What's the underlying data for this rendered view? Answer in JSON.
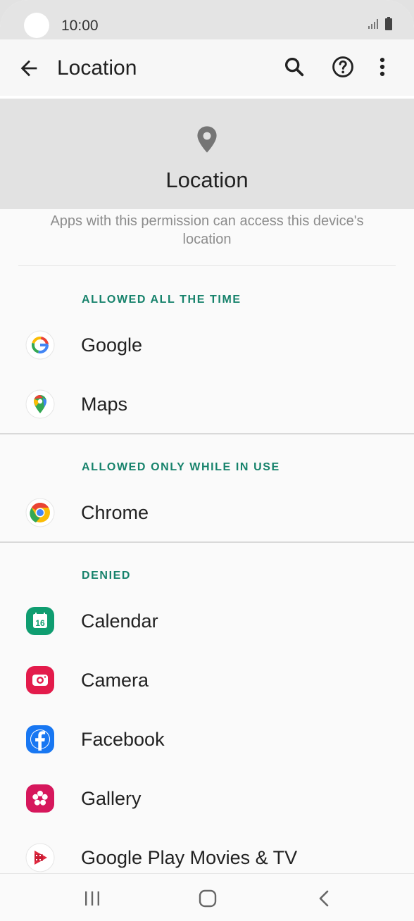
{
  "status_bar": {
    "time": "10:00"
  },
  "app_bar": {
    "title": "Location"
  },
  "header": {
    "title": "Location",
    "description": "Apps with this permission can access this device's location"
  },
  "sections": [
    {
      "heading": "ALLOWED ALL THE TIME",
      "apps": [
        {
          "name": "Google"
        },
        {
          "name": "Maps"
        }
      ]
    },
    {
      "heading": "ALLOWED ONLY WHILE IN USE",
      "apps": [
        {
          "name": "Chrome"
        }
      ]
    },
    {
      "heading": "DENIED",
      "apps": [
        {
          "name": "Calendar",
          "icon_text": "16"
        },
        {
          "name": "Camera"
        },
        {
          "name": "Facebook"
        },
        {
          "name": "Gallery"
        },
        {
          "name": "Google Play Movies & TV"
        }
      ]
    }
  ],
  "colors": {
    "section_heading": "#16826b",
    "hero_bg": "#e2e2e2"
  }
}
